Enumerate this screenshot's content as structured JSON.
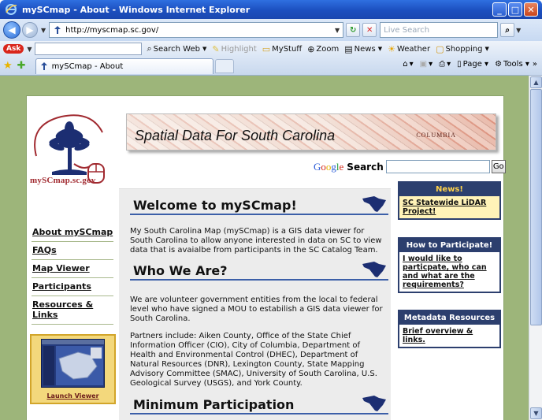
{
  "window": {
    "title": "mySCmap - About - Windows Internet Explorer"
  },
  "address_bar": {
    "url": "http://myscmap.sc.gov/",
    "search_placeholder": "Live Search"
  },
  "ask_toolbar": {
    "logo": "Ask",
    "items": [
      "Search Web",
      "Highlight",
      "MyStuff",
      "Zoom",
      "News",
      "Weather",
      "Shopping"
    ]
  },
  "tabs": {
    "active_tab": "mySCmap - About"
  },
  "commands": {
    "page": "Page",
    "tools": "Tools"
  },
  "site": {
    "logo_text": "mySCmap.sc.gov",
    "banner_title": "Spatial Data For South Carolina",
    "banner_city": "COLUMBIA",
    "google_label": "Google",
    "search_label": "Search",
    "go_button": "Go"
  },
  "nav": {
    "items": [
      "About mySCmap",
      "FAQs",
      "Map Viewer",
      "Participants",
      "Resources & Links"
    ],
    "launch_caption": "Launch Viewer"
  },
  "main": {
    "welcome_heading": "Welcome to mySCmap!",
    "welcome_text": "My South Carolina Map (mySCmap) is a GIS data viewer for South Carolina to allow anyone interested in data on SC to view data that is avaialbe from participants in the SC Catalog Team.",
    "who_heading": "Who We Are?",
    "who_text_1": "We are volunteer government entities from the local to federal level who have signed a MOU to estabilish a GIS data viewer for South Carolina.",
    "who_text_2": "Partners include: Aiken County, Office of the State Chief Information Officer (CIO), City of Columbia, Department of Health and Environmental Control (DHEC), Department of Natural Resources (DNR), Lexington County, State Mapping Advisory Committee (SMAC), University of South Carolina, U.S. Geological Survey (USGS), and York County.",
    "min_heading": "Minimum Participation"
  },
  "right": {
    "news_title": "News!",
    "news_link": "SC Statewide LiDAR Project!",
    "participate_title": "How to Participate!",
    "participate_link": "I would like to particpate, who can and what are the requirements?",
    "metadata_title": "Metadata Resources",
    "metadata_link": "Brief overview & links."
  },
  "colors": {
    "page_background": "#9db57a",
    "heading_rule": "#3c5fa8",
    "logo_red": "#a12a30",
    "box_navy": "#2c3f6e"
  }
}
